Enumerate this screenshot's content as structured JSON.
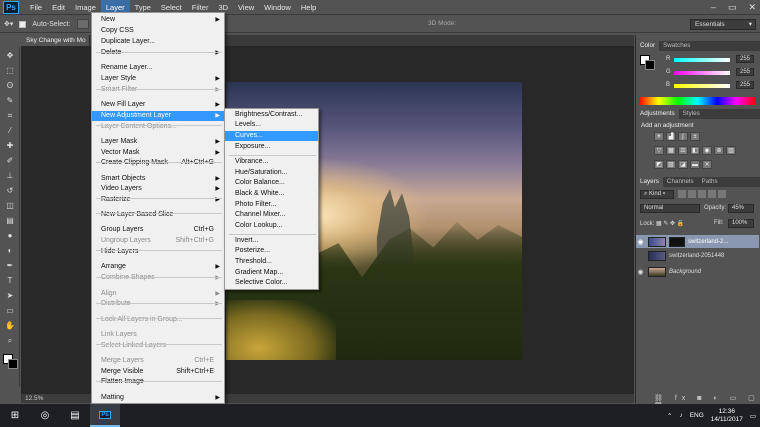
{
  "menubar": {
    "logo": "Ps",
    "items": [
      "File",
      "Edit",
      "Image",
      "Layer",
      "Type",
      "Select",
      "Filter",
      "3D",
      "View",
      "Window",
      "Help"
    ],
    "window_controls": [
      "–",
      "▭",
      "✕"
    ]
  },
  "options_bar": {
    "auto_select_label": "Auto-Select:",
    "threed_mode_label": "3D Mode:",
    "workspace": "Essentials"
  },
  "doc_tabs": [
    {
      "label": "Sky Change with Mo"
    },
    {
      "label": "@ 12.5% (Curves 1, Layer Mask/8) *"
    }
  ],
  "layer_menu": {
    "items": [
      {
        "label": "New",
        "arrow": true
      },
      {
        "label": "Copy CSS"
      },
      {
        "label": "Duplicate Layer..."
      },
      {
        "label": "Delete",
        "arrow": true
      },
      {
        "label": "Rename Layer..."
      },
      {
        "label": "Layer Style",
        "arrow": true
      },
      {
        "label": "Smart Filter",
        "arrow": true,
        "disabled": true
      },
      {
        "label": "New Fill Layer",
        "arrow": true
      },
      {
        "label": "New Adjustment Layer",
        "arrow": true,
        "highlighted": true
      },
      {
        "label": "Layer Content Options...",
        "disabled": true
      },
      {
        "label": "Layer Mask",
        "arrow": true
      },
      {
        "label": "Vector Mask",
        "arrow": true
      },
      {
        "label": "Create Clipping Mask",
        "shortcut": "Alt+Ctrl+G"
      },
      {
        "label": "Smart Objects",
        "arrow": true
      },
      {
        "label": "Video Layers",
        "arrow": true
      },
      {
        "label": "Rasterize",
        "arrow": true
      },
      {
        "label": "New Layer Based Slice"
      },
      {
        "label": "Group Layers",
        "shortcut": "Ctrl+G"
      },
      {
        "label": "Ungroup Layers",
        "shortcut": "Shift+Ctrl+G",
        "disabled": true
      },
      {
        "label": "Hide Layers"
      },
      {
        "label": "Arrange",
        "arrow": true
      },
      {
        "label": "Combine Shapes",
        "arrow": true,
        "disabled": true
      },
      {
        "label": "Align",
        "arrow": true,
        "disabled": true
      },
      {
        "label": "Distribute",
        "arrow": true,
        "disabled": true
      },
      {
        "label": "Lock All Layers in Group...",
        "disabled": true
      },
      {
        "label": "Link Layers",
        "disabled": true
      },
      {
        "label": "Select Linked Layers",
        "disabled": true
      },
      {
        "label": "Merge Layers",
        "shortcut": "Ctrl+E",
        "disabled": true
      },
      {
        "label": "Merge Visible",
        "shortcut": "Shift+Ctrl+E"
      },
      {
        "label": "Flatten Image"
      },
      {
        "label": "Matting",
        "arrow": true
      }
    ]
  },
  "adjustment_submenu": {
    "items": [
      {
        "label": "Brightness/Contrast..."
      },
      {
        "label": "Levels..."
      },
      {
        "label": "Curves...",
        "highlighted": true
      },
      {
        "label": "Exposure..."
      },
      {
        "label": "Vibrance..."
      },
      {
        "label": "Hue/Saturation..."
      },
      {
        "label": "Color Balance..."
      },
      {
        "label": "Black & White..."
      },
      {
        "label": "Photo Filter..."
      },
      {
        "label": "Channel Mixer..."
      },
      {
        "label": "Color Lookup..."
      },
      {
        "label": "Invert..."
      },
      {
        "label": "Posterize..."
      },
      {
        "label": "Threshold..."
      },
      {
        "label": "Gradient Map..."
      },
      {
        "label": "Selective Color..."
      }
    ]
  },
  "status": {
    "zoom": "12.5%"
  },
  "color_panel": {
    "tabs": [
      "Color",
      "Swatches"
    ],
    "channels": [
      {
        "label": "R",
        "value": "255"
      },
      {
        "label": "G",
        "value": "255"
      },
      {
        "label": "B",
        "value": "255"
      }
    ]
  },
  "adjustments_panel": {
    "tabs": [
      "Adjustments",
      "Styles"
    ],
    "heading": "Add an adjustment"
  },
  "layers_panel": {
    "tabs": [
      "Layers",
      "Channels",
      "Paths"
    ],
    "kind_label": "Kind",
    "blend_mode": "Normal",
    "opacity_label": "Opacity:",
    "opacity": "45%",
    "fill_label": "Fill:",
    "fill": "100%",
    "layers": [
      {
        "name": "switzerland-2...",
        "selected": true,
        "visible": true
      },
      {
        "name": "switzerland-2051448",
        "visible": false
      },
      {
        "name": "Background",
        "visible": true
      }
    ]
  },
  "taskbar": {
    "language": "ENG",
    "time": "12:36",
    "date": "14/11/2017"
  },
  "colors": {
    "menu_highlight": "#3399ff",
    "app_bg": "#535353",
    "canvas_bg": "#282828"
  }
}
